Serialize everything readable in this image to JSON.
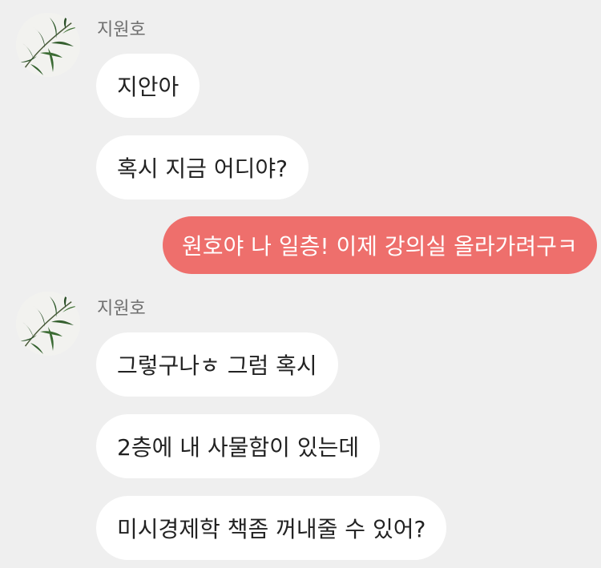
{
  "colors": {
    "background": "#efefef",
    "incoming_bubble": "#ffffff",
    "outgoing_bubble": "#ee6f6c",
    "sender_name": "#6f6f6f"
  },
  "groups": [
    {
      "sender": "지원호",
      "avatar_icon": "bamboo-leaves-avatar",
      "messages": [
        "지안아",
        "혹시 지금 어디야?"
      ]
    },
    {
      "outgoing": true,
      "messages": [
        "원호야 나 일층! 이제 강의실 올라가려구ㅋ"
      ]
    },
    {
      "sender": "지원호",
      "avatar_icon": "bamboo-leaves-avatar",
      "messages": [
        "그렇구나ㅎ 그럼 혹시",
        "2층에 내 사물함이 있는데",
        "미시경제학 책좀 꺼내줄 수 있어?"
      ]
    }
  ]
}
